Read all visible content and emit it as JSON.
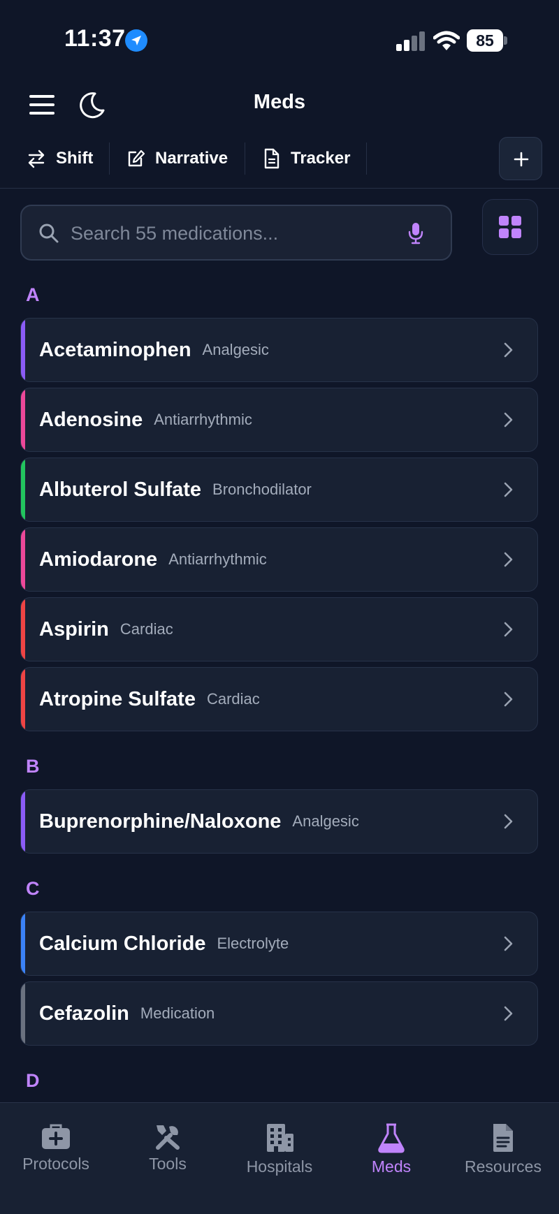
{
  "status_bar": {
    "time": "11:37",
    "battery": "85"
  },
  "header": {
    "title": "Meds"
  },
  "toolbar": {
    "shift_label": "Shift",
    "narrative_label": "Narrative",
    "tracker_label": "Tracker"
  },
  "search": {
    "placeholder": "Search 55 medications..."
  },
  "sections": [
    {
      "letter": "A",
      "items": [
        {
          "name": "Acetaminophen",
          "category": "Analgesic",
          "accent": "#8b5cf6"
        },
        {
          "name": "Adenosine",
          "category": "Antiarrhythmic",
          "accent": "#ec4899"
        },
        {
          "name": "Albuterol Sulfate",
          "category": "Bronchodilator",
          "accent": "#22c55e"
        },
        {
          "name": "Amiodarone",
          "category": "Antiarrhythmic",
          "accent": "#ec4899"
        },
        {
          "name": "Aspirin",
          "category": "Cardiac",
          "accent": "#ef4444"
        },
        {
          "name": "Atropine Sulfate",
          "category": "Cardiac",
          "accent": "#ef4444"
        }
      ]
    },
    {
      "letter": "B",
      "items": [
        {
          "name": "Buprenorphine/Naloxone",
          "category": "Analgesic",
          "accent": "#8b5cf6"
        }
      ]
    },
    {
      "letter": "C",
      "items": [
        {
          "name": "Calcium Chloride",
          "category": "Electrolyte",
          "accent": "#3b82f6"
        },
        {
          "name": "Cefazolin",
          "category": "Medication",
          "accent": "#6b7280"
        }
      ]
    },
    {
      "letter": "D",
      "items": []
    }
  ],
  "bottom_nav": {
    "items": [
      {
        "label": "Protocols",
        "icon": "briefcase-medical-icon"
      },
      {
        "label": "Tools",
        "icon": "tools-icon"
      },
      {
        "label": "Hospitals",
        "icon": "building-icon"
      },
      {
        "label": "Meds",
        "icon": "flask-icon",
        "active": true
      },
      {
        "label": "Resources",
        "icon": "document-icon"
      }
    ]
  },
  "colors": {
    "accent": "#c084fc",
    "background": "#0f1628",
    "card": "#182133"
  }
}
